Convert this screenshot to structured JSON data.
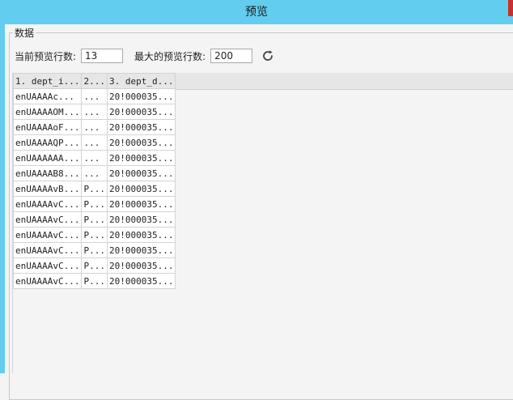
{
  "window": {
    "title": "预览"
  },
  "group": {
    "legend": "数据"
  },
  "fields": {
    "current_rows_label": "当前预览行数:",
    "current_rows_value": "13",
    "max_rows_label": "最大的预览行数:",
    "max_rows_value": "200"
  },
  "icons": {
    "refresh": "refresh-icon"
  },
  "table": {
    "headers": [
      "1. dept_i...",
      "2...",
      "3. dept_d..."
    ],
    "rows": [
      [
        "enUAAAAc...",
        "...",
        "20!000035..."
      ],
      [
        "enUAAAAOM...",
        "...",
        "20!000035..."
      ],
      [
        "enUAAAAoF...",
        "...",
        "20!000035..."
      ],
      [
        "enUAAAAQP...",
        "...",
        "20!000035..."
      ],
      [
        "enUAAAAAA...",
        "...",
        "20!000035..."
      ],
      [
        "enUAAAAB8...",
        "...",
        "20!000035..."
      ],
      [
        "enUAAAAvB...",
        "P...",
        "20!000035..."
      ],
      [
        "enUAAAAvC...",
        "P...",
        "20!000035..."
      ],
      [
        "enUAAAAvC...",
        "P...",
        "20!000035..."
      ],
      [
        "enUAAAAvC...",
        "P...",
        "20!000035..."
      ],
      [
        "enUAAAAvC...",
        "P...",
        "20!000035..."
      ],
      [
        "enUAAAAvC...",
        "P...",
        "20!000035..."
      ],
      [
        "enUAAAAvC...",
        "P...",
        "20!000035..."
      ]
    ]
  },
  "colors": {
    "titlebar": "#62cdef",
    "background": "#f4f4f4"
  }
}
